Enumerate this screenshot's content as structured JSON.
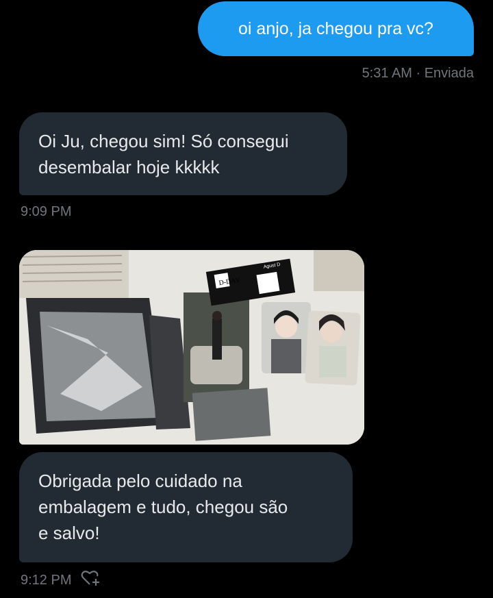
{
  "messages": {
    "sent": {
      "text": "oi anjo, ja chegou pra vc?",
      "time": "5:31 AM · Enviada"
    },
    "received1": {
      "line1": "Oi Ju, chegou sim! Só consegui",
      "line2": "desembalar hoje kkkkk",
      "time": "9:09 PM"
    },
    "received2": {
      "line1": "Obrigada pelo cuidado na",
      "line2": "embalagem e tudo, chegou são",
      "line3": "e salvo!",
      "time": "9:12 PM"
    }
  },
  "photo": {
    "card_title": "D-DAY",
    "card_name": "Agust D"
  },
  "icons": {
    "reaction": "heart-plus-icon"
  },
  "colors": {
    "background": "#000000",
    "sent_bubble": "#1d9bf0",
    "received_bubble": "#222b33",
    "text": "#e7e9ea",
    "muted": "#71767b"
  }
}
